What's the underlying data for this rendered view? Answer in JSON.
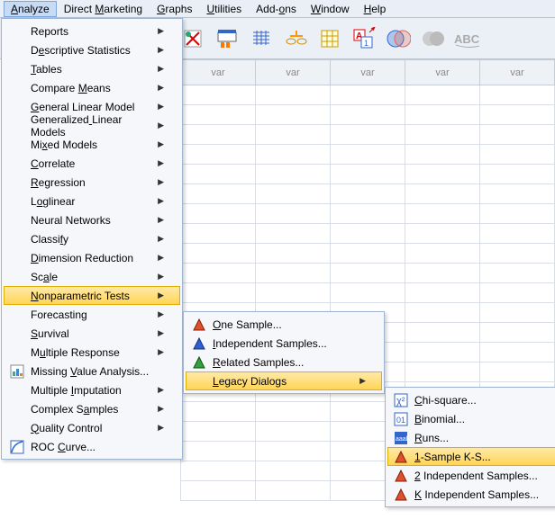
{
  "menubar": {
    "items": [
      "Analyze",
      "Direct Marketing",
      "Graphs",
      "Utilities",
      "Add-ons",
      "Window",
      "Help"
    ],
    "open_index": 0,
    "underlines": [
      0,
      7,
      0,
      0,
      4,
      0,
      0
    ]
  },
  "sheet": {
    "col_header": "var",
    "cols": 5,
    "rows": 21
  },
  "analyze_menu": {
    "items": [
      {
        "label": "Reports",
        "sub": true,
        "u": -1
      },
      {
        "label": "Descriptive Statistics",
        "sub": true,
        "u": 1
      },
      {
        "label": "Tables",
        "sub": true,
        "u": 0
      },
      {
        "label": "Compare Means",
        "sub": true,
        "u": 8
      },
      {
        "label": "General Linear Model",
        "sub": true,
        "u": 0
      },
      {
        "label": "Generalized Linear Models",
        "sub": true,
        "u": 11
      },
      {
        "label": "Mixed Models",
        "sub": true,
        "u": 2
      },
      {
        "label": "Correlate",
        "sub": true,
        "u": 0
      },
      {
        "label": "Regression",
        "sub": true,
        "u": 0
      },
      {
        "label": "Loglinear",
        "sub": true,
        "u": 1
      },
      {
        "label": "Neural Networks",
        "sub": true,
        "u": -1
      },
      {
        "label": "Classify",
        "sub": true,
        "u": 6
      },
      {
        "label": "Dimension Reduction",
        "sub": true,
        "u": 0
      },
      {
        "label": "Scale",
        "sub": true,
        "u": 2
      },
      {
        "label": "Nonparametric Tests",
        "sub": true,
        "u": 0,
        "hi": true
      },
      {
        "label": "Forecasting",
        "sub": true,
        "u": -1
      },
      {
        "label": "Survival",
        "sub": true,
        "u": 0
      },
      {
        "label": "Multiple Response",
        "sub": true,
        "u": 1
      },
      {
        "label": "Missing Value Analysis...",
        "sub": false,
        "u": 8,
        "icon": "chart-icon"
      },
      {
        "label": "Multiple Imputation",
        "sub": true,
        "u": 9
      },
      {
        "label": "Complex Samples",
        "sub": true,
        "u": 9
      },
      {
        "label": "Quality Control",
        "sub": true,
        "u": 0
      },
      {
        "label": "ROC Curve...",
        "sub": false,
        "u": 4,
        "icon": "roc-icon"
      }
    ]
  },
  "nonparam_menu": {
    "items": [
      {
        "label": "One Sample...",
        "u": 0,
        "icon": "tri-red"
      },
      {
        "label": "Independent Samples...",
        "u": 0,
        "icon": "tri-blue"
      },
      {
        "label": "Related Samples...",
        "u": 0,
        "icon": "tri-green"
      },
      {
        "label": "Legacy Dialogs",
        "u": 0,
        "sub": true,
        "hi": true
      }
    ]
  },
  "legacy_menu": {
    "items": [
      {
        "label": "Chi-square...",
        "u": 0,
        "icon": "chi-icon"
      },
      {
        "label": "Binomial...",
        "u": 0,
        "icon": "bin-icon"
      },
      {
        "label": "Runs...",
        "u": 0,
        "icon": "runs-icon"
      },
      {
        "label": "1-Sample K-S...",
        "u": 0,
        "icon": "tri-red",
        "hi": true
      },
      {
        "label": "2 Independent Samples...",
        "u": 0,
        "icon": "tri-red"
      },
      {
        "label": "K Independent Samples...",
        "u": 0,
        "icon": "tri-red"
      }
    ]
  }
}
